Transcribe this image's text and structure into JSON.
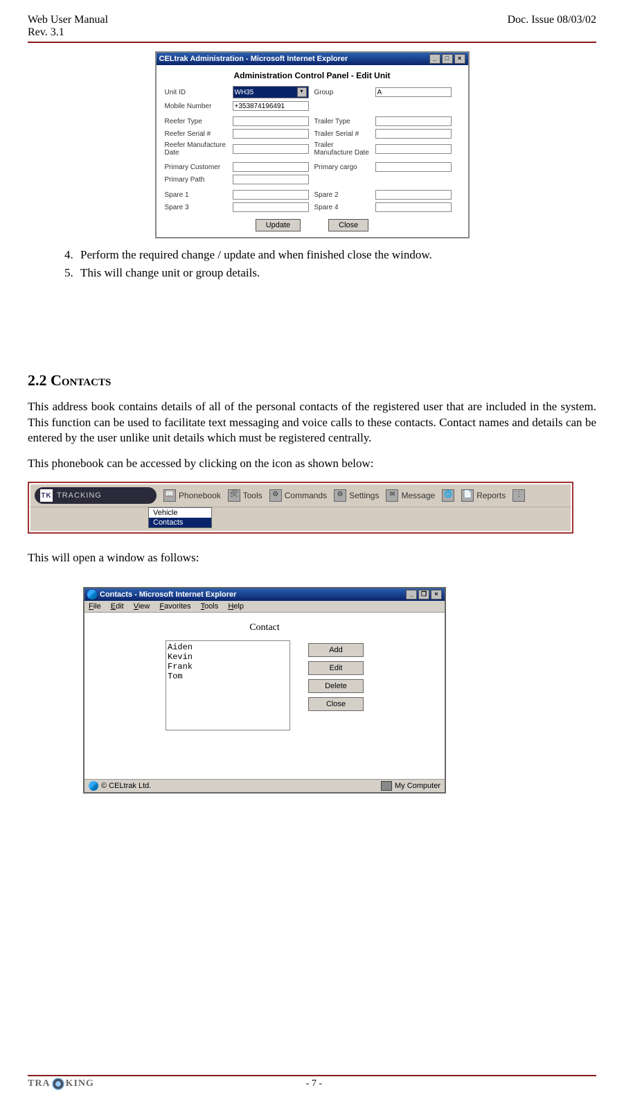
{
  "header": {
    "left_line1": "Web User Manual",
    "left_line2": "Rev. 3.1",
    "right": "Doc. Issue 08/03/02"
  },
  "admin_window": {
    "title": "CELtrak Administration - Microsoft Internet Explorer",
    "panel_title": "Administration Control Panel - Edit Unit",
    "fields": {
      "unit_id_label": "Unit ID",
      "unit_id_value": "WH35",
      "group_label": "Group",
      "group_value": "A",
      "mobile_label": "Mobile Number",
      "mobile_value": "+353874196491",
      "reefer_type_label": "Reefer Type",
      "trailer_type_label": "Trailer Type",
      "reefer_serial_label": "Reefer Serial #",
      "trailer_serial_label": "Trailer Serial #",
      "reefer_mfg_label": "Reefer Manufacture Date",
      "trailer_mfg_label": "Trailer Manufacture Date",
      "primary_customer_label": "Primary Customer",
      "primary_cargo_label": "Primary cargo",
      "primary_path_label": "Primary Path",
      "spare1_label": "Spare 1",
      "spare2_label": "Spare 2",
      "spare3_label": "Spare 3",
      "spare4_label": "Spare 4"
    },
    "buttons": {
      "update": "Update",
      "close": "Close"
    }
  },
  "list_items": {
    "4": "Perform the required change / update and when finished close the window.",
    "5": "This will change unit or group details."
  },
  "section": {
    "number": "2.2",
    "name": "Contacts"
  },
  "paragraphs": {
    "p1": "This address book contains details of all of the personal contacts of the registered user that are included in the system.  This function can be used to facilitate text messaging and voice calls to these contacts. Contact names and details can be entered by the user unlike unit details which must be registered centrally.",
    "p2": "This phonebook can be accessed by clicking on the icon as shown below:",
    "p3": "This will open a window as follows:"
  },
  "toolbar": {
    "logo_text": "TRACKING",
    "menu": {
      "phonebook": "Phonebook",
      "tools": "Tools",
      "commands": "Commands",
      "settings": "Settings",
      "message": "Message",
      "reports": "Reports"
    },
    "dropdown": {
      "option1": "Vehicle",
      "option2": "Contacts"
    }
  },
  "contacts_window": {
    "title": "Contacts - Microsoft Internet Explorer",
    "menubar": {
      "file": "File",
      "edit": "Edit",
      "view": "View",
      "favorites": "Favorites",
      "tools": "Tools",
      "help": "Help"
    },
    "heading": "Contact",
    "list": [
      "Aiden",
      "Kevin",
      "Frank",
      "Tom"
    ],
    "buttons": {
      "add": "Add",
      "edit": "Edit",
      "delete": "Delete",
      "close": "Close"
    },
    "statusbar": {
      "left": "© CELtrak Ltd.",
      "right": "My Computer"
    }
  },
  "footer": {
    "logo_text": "TRACKING",
    "page_num": "- 7 -"
  }
}
